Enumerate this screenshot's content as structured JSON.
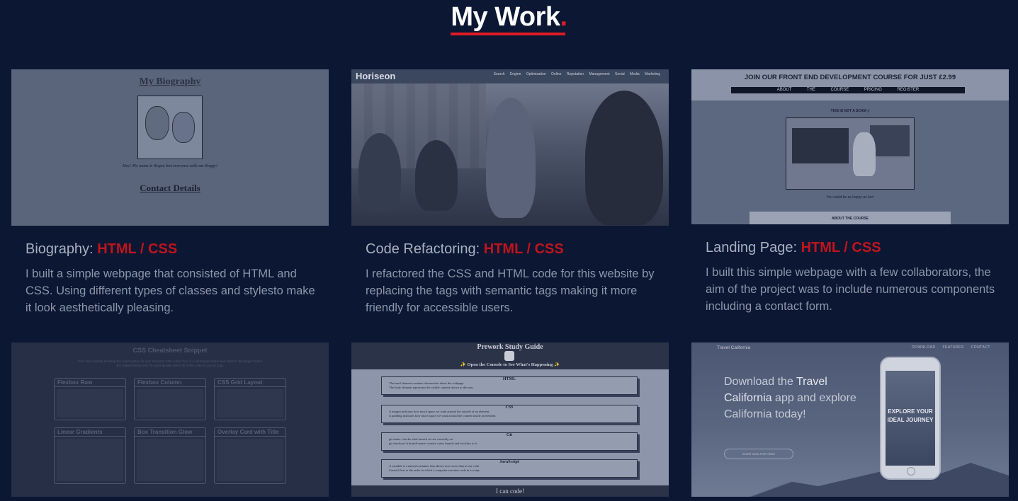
{
  "section": {
    "title": "My Work",
    "dot": "."
  },
  "projects": [
    {
      "name": "Biography:",
      "tech": "HTML / CSS",
      "description": "I built a simple webpage that consisted of HTML and CSS. Using different types of classes and stylesto make it look aesthetically pleasing.",
      "preview": {
        "title": "My Biography",
        "caption": "Hey! My name is Roger, but everyone calls me Roggy!",
        "contact": "Contact Details"
      }
    },
    {
      "name": "Code Refactoring:",
      "tech": "HTML / CSS",
      "description": "I refactored the CSS and HTML code for this website by replacing the tags with semantic tags making it more friendly for accessible users.",
      "preview": {
        "logo": "Horiseon",
        "links": "Search Engine Optimization   Online Reputation Management   Social Media Marketing"
      }
    },
    {
      "name": "Landing Page:",
      "tech": "HTML / CSS",
      "description": "I built this simple webpage with a few collaborators, the aim of the project was to include numerous components including a contact form.",
      "preview": {
        "headline": "JOIN OUR FRONT END DEVELOPMENT COURSE FOR JUST £2.99",
        "nav": "ABOUT THE COURSE   PRICING   REGISTER",
        "scam": "THIS IS NOT A SCAM :)",
        "happy": "You could be as happy as her!",
        "button": "ABOUT THE COURSE"
      }
    },
    {
      "preview": {
        "title": "CSS Cheatsheet Snippet",
        "subtitle": "Ever have trouble recalling the exact syntax for your favourite CSS code? Give it a permanent home and add it to this page! Select any snippet below and it'll automatically select all of the code for you to copy.",
        "boxes": [
          "Flexbox Row",
          "Flexbox Column",
          "CSS Grid Layout",
          "Linear Gradients",
          "Box Transition Glow",
          "Overlay Card with Title"
        ]
      }
    },
    {
      "preview": {
        "title": "Prework Study Guide",
        "subtitle": "✨ Open the Console to See What's Happening ✨",
        "blocks": [
          {
            "heading": "HTML",
            "lines": [
              "The head element contains information about the webpage.",
              "The body element represents the visible content shown to the user."
            ]
          },
          {
            "heading": "CSS",
            "lines": [
              "A margin indicates how much space we want around the outside of an element.",
              "A padding indicates how much space we want around the content inside an element."
            ]
          },
          {
            "heading": "Git",
            "lines": [
              "git status: checks what branch we are currently on",
              "git checkout -b branch-name: creates a new branch and switches to it"
            ]
          },
          {
            "heading": "JavaScript",
            "lines": [
              "A variable is a named container that allows us to store data in our code.",
              "Control flow is the order in which a computer executes code in a script."
            ]
          }
        ],
        "footer": "I can code!"
      }
    },
    {
      "preview": {
        "brand": "Travel California",
        "nav": "DOWNLOAD   FEATURES   CONTACT",
        "headline_pre": "Download the ",
        "headline_bold": "Travel California",
        "headline_post": " app and explore California today!",
        "cta": "START NOW FOR FREE!",
        "phone_text": "EXPLORE YOUR IDEAL JOURNEY"
      }
    }
  ]
}
